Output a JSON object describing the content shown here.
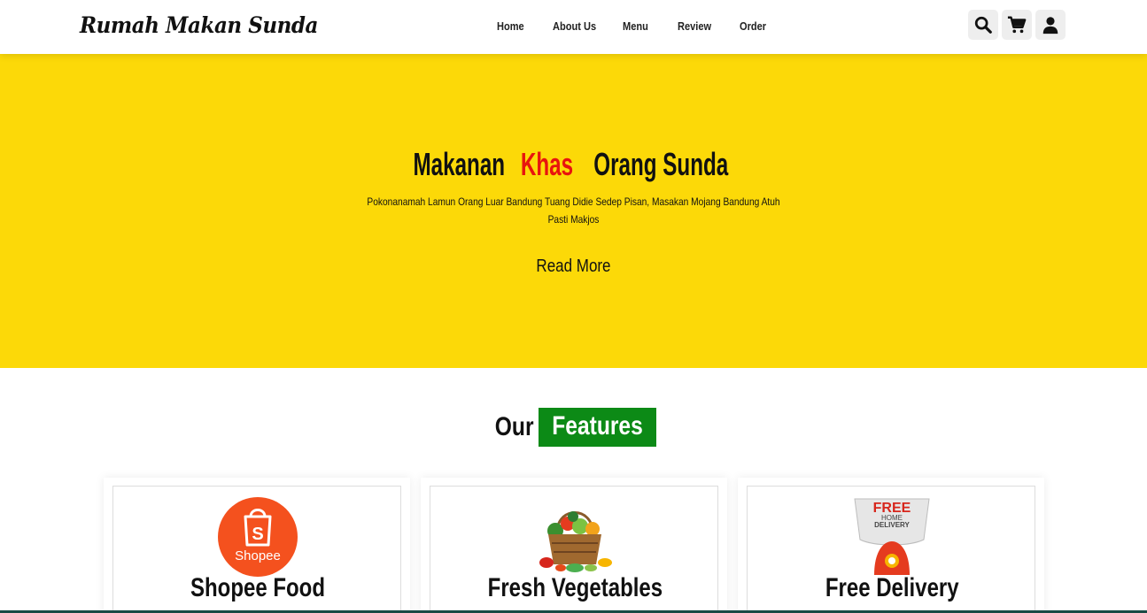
{
  "header": {
    "logo": "Rumah Makan Sunda",
    "nav": [
      "Home",
      "About Us",
      "Menu",
      "Review",
      "Order"
    ],
    "icons": [
      "search-icon",
      "cart-icon",
      "user-icon"
    ]
  },
  "hero": {
    "title_part1": "Makanan ",
    "title_accent": "Khas",
    "title_part2": " Orang Sunda",
    "subtitle": "Pokonanamah Lamun Orang Luar Bandung Tuang Didie Sedep Pisan, Masakan Mojang Bandung Atuh Pasti Makjos",
    "button": "Read More"
  },
  "features": {
    "title_plain": "Our ",
    "title_highlight": "Features",
    "cards": [
      {
        "title": "Shopee Food",
        "image": "shopee-logo",
        "logo_text": "Shopee"
      },
      {
        "title": "Fresh Vegetables",
        "image": "vegetable-basket"
      },
      {
        "title": "Free Delivery",
        "image": "free-delivery-scooter",
        "badge_line1": "FREE",
        "badge_line2": "HOME",
        "badge_line3": "DELIVERY"
      }
    ]
  },
  "colors": {
    "hero_bg": "#fcd908",
    "accent_red": "#e8140e",
    "highlight_green": "#0c8a16",
    "shopee_orange": "#f4511e"
  }
}
